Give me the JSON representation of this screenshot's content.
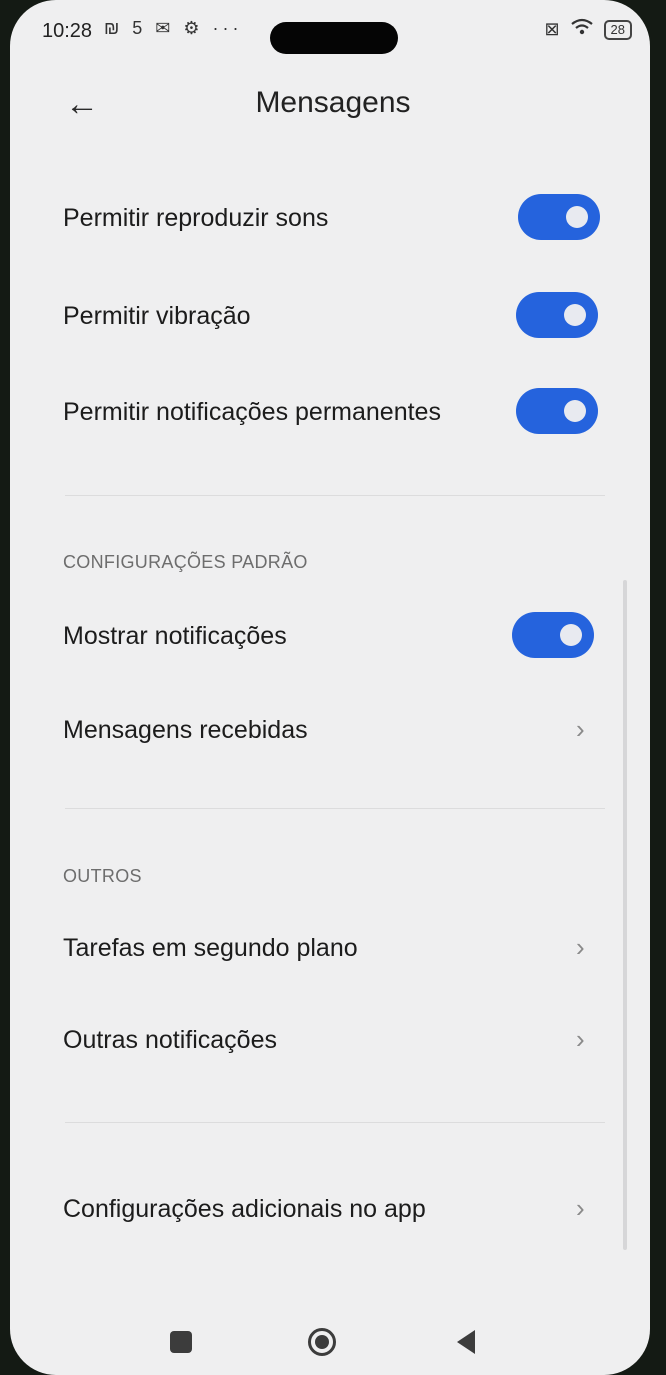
{
  "status_bar": {
    "time": "10:28",
    "left_icons": "₪ 5 ✉ ⚙ ···",
    "battery": "28"
  },
  "header": {
    "title": "Mensagens",
    "back_icon": "arrow-left-icon"
  },
  "toggles_top": [
    {
      "label": "Permitir reproduzir sons",
      "on": true
    },
    {
      "label": "Permitir vibração",
      "on": true
    },
    {
      "label": "Permitir notificações permanentes",
      "on": true
    }
  ],
  "section_default": {
    "header": "CONFIGURAÇÕES PADRÃO",
    "show_notifications": {
      "label": "Mostrar notificações",
      "on": true
    },
    "received_messages": {
      "label": "Mensagens recebidas"
    }
  },
  "section_others": {
    "header": "OUTROS",
    "items": [
      {
        "label": "Tarefas em segundo plano"
      },
      {
        "label": "Outras notificações"
      }
    ]
  },
  "additional": {
    "label": "Configurações adicionais no app"
  },
  "colors": {
    "toggle_on": "#2563dd",
    "background": "#efeff0"
  },
  "navbar": {
    "recent_icon": "square-icon",
    "home_icon": "circle-icon",
    "back_icon": "triangle-icon"
  }
}
